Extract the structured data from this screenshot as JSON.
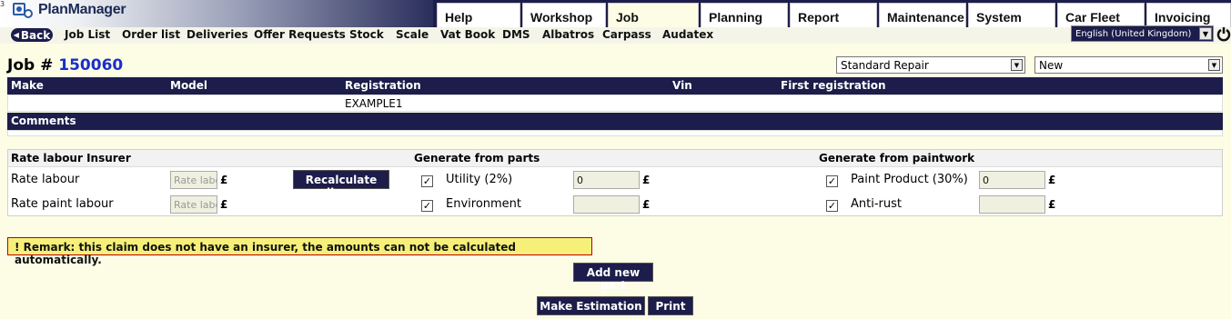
{
  "app": {
    "logo_text": "PlanManager",
    "corner_mark": "3"
  },
  "tabs": [
    {
      "label": "Help"
    },
    {
      "label": "Workshop"
    },
    {
      "label": "Job"
    },
    {
      "label": "Planning"
    },
    {
      "label": "Report"
    },
    {
      "label": "Maintenance"
    },
    {
      "label": "System"
    },
    {
      "label": "Car Fleet"
    },
    {
      "label": "Invoicing"
    }
  ],
  "active_tab": "Job",
  "subnav": {
    "back_label": "Back",
    "links": [
      "Job List",
      "Order list",
      "Deliveries",
      "Offer Requests",
      "Stock",
      "Scale",
      "Vat Book",
      "DMS",
      "Albatros",
      "Carpass",
      "Audatex"
    ]
  },
  "language": {
    "selected": "English (United Kingdom)"
  },
  "job": {
    "prefix": "Job #",
    "number": "150060",
    "type_select": "Standard Repair",
    "status_select": "New"
  },
  "vehicle": {
    "headers": {
      "make": "Make",
      "model": "Model",
      "registration": "Registration",
      "vin": "Vin",
      "first_registration": "First registration"
    },
    "row": {
      "make": "",
      "model": "",
      "registration": "EXAMPLE1",
      "vin": "",
      "first_registration": ""
    }
  },
  "comments": {
    "header": "Comments"
  },
  "rates": {
    "col1_header": "Rate labour Insurer",
    "col2_header": "Generate from parts",
    "col3_header": "Generate from paintwork",
    "rate_labour_label": "Rate labour",
    "rate_paint_label": "Rate paint labour",
    "rate_placeholder": "Rate labour",
    "recalculate_label": "Recalculate lines",
    "currency": "£",
    "utility_label": "Utility (2%)",
    "utility_value": "0",
    "environment_label": "Environment",
    "environment_value": "",
    "paint_product_label": "Paint Product (30%)",
    "paint_product_value": "0",
    "anti_rust_label": "Anti-rust",
    "anti_rust_value": "",
    "checkbox_mark": "✓"
  },
  "remark": {
    "icon": "!",
    "text": "Remark: this claim does not have an insurer, the amounts can not be calculated automatically."
  },
  "actions": {
    "add_part": "Add new part",
    "make_estimation": "Make Estimation",
    "print": "Print"
  }
}
